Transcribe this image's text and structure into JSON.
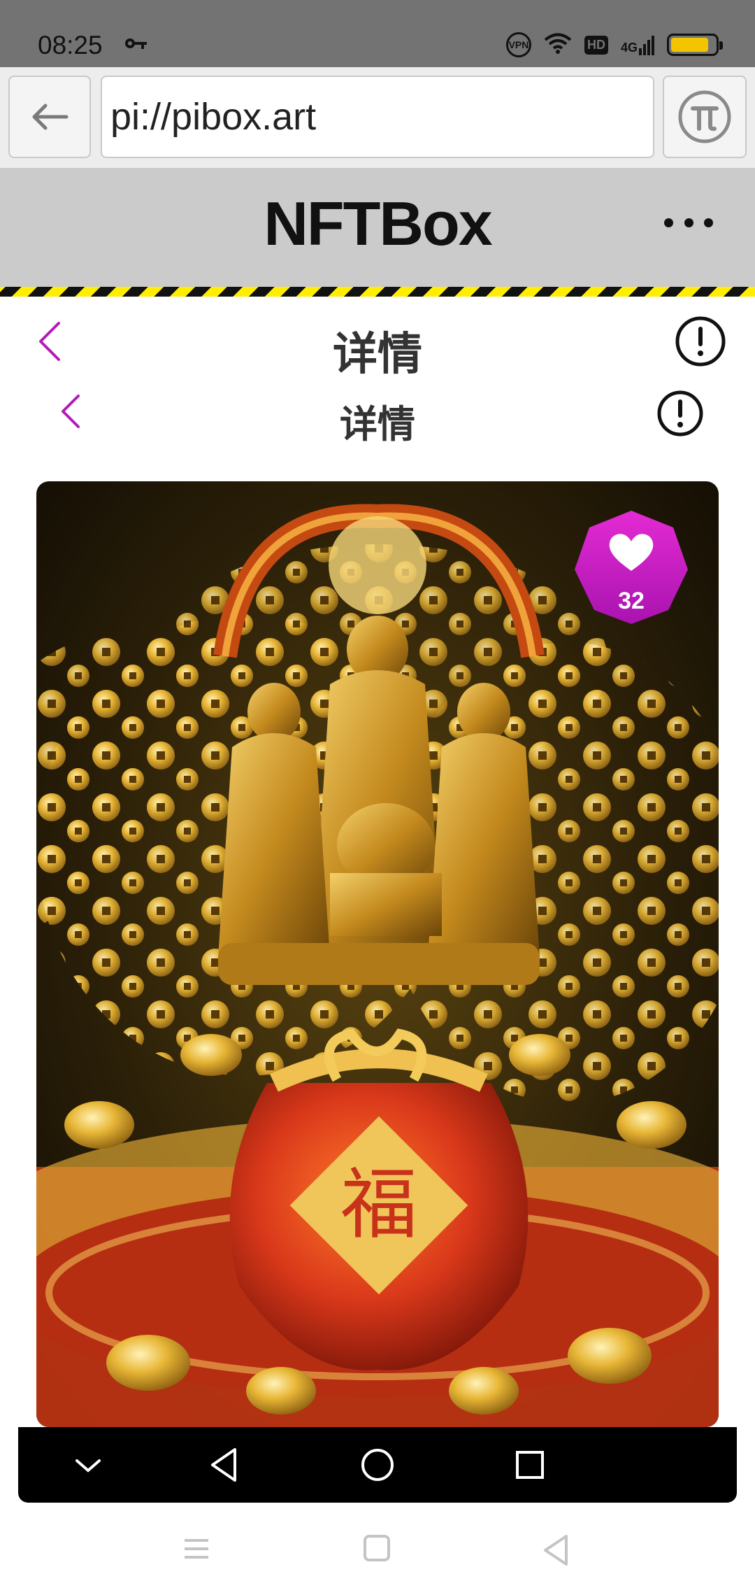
{
  "status_bar": {
    "time": "08:25",
    "vpn_label": "VPN",
    "hd_label": "HD",
    "network_label": "4G",
    "battery_level": 0.85,
    "icons": [
      "key-icon",
      "vpn-icon",
      "wifi-icon",
      "hd-icon",
      "signal-icon",
      "battery-icon"
    ]
  },
  "browser": {
    "url": "pi://pibox.art",
    "back_icon": "arrow-left-icon",
    "pi_icon": "pi-logo-icon"
  },
  "app": {
    "title": "NFTBox",
    "menu_icon": "more-dots-icon"
  },
  "detail": {
    "title_primary": "详情",
    "title_secondary": "详情"
  },
  "nft": {
    "like_count": "32",
    "artwork_character": "福"
  },
  "colors": {
    "accent_purple": "#b21bb8",
    "like_badge": "#d319c6",
    "hazard_yellow": "#ffee00",
    "header_gray": "#cbcbcb",
    "status_gray": "#737373"
  }
}
